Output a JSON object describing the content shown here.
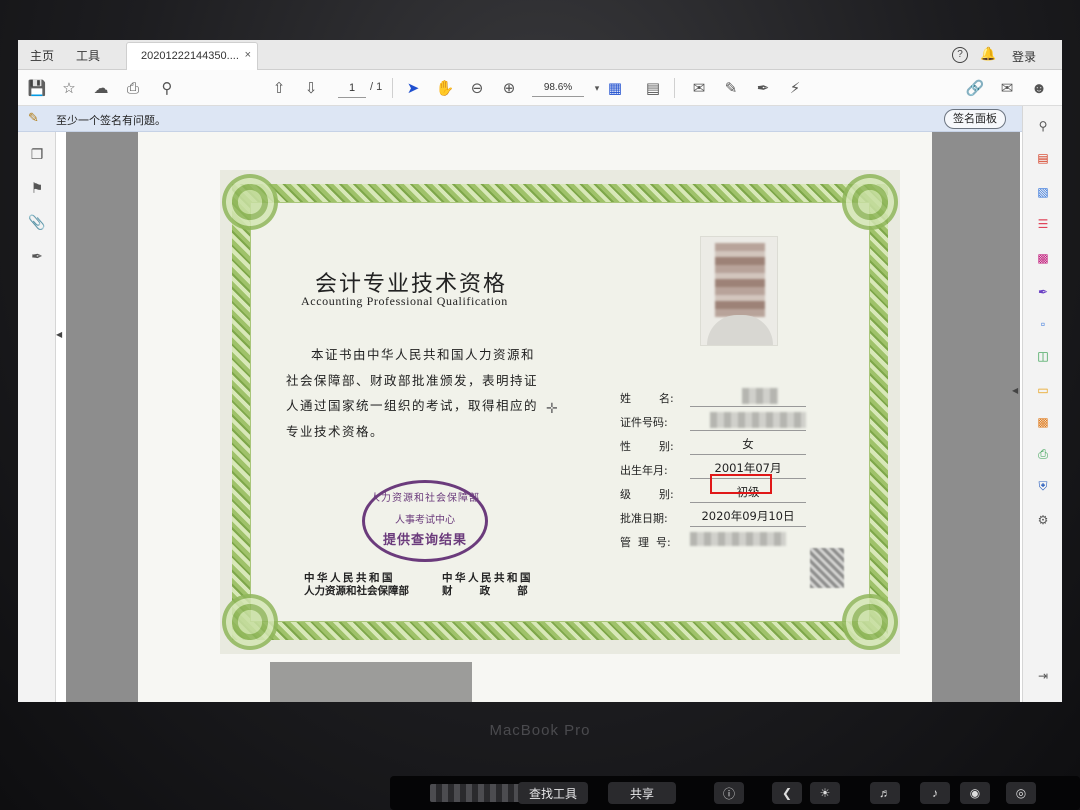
{
  "tabs": {
    "home": "主页",
    "tools": "工具",
    "document": "20201222144350....",
    "close": "×",
    "help": "?",
    "login": "登录"
  },
  "toolbar": {
    "page_current": "1",
    "page_total": "/ 1",
    "zoom": "98.6%"
  },
  "signature_bar": {
    "message": "至少一个签名有问题。",
    "panel_button": "签名面板"
  },
  "certificate": {
    "title": "会计专业技术资格",
    "subtitle": "Accounting Professional Qualification",
    "body": "本证书由中华人民共和国人力资源和社会保障部、财政部批准颁发，表明持证人通过国家统一组织的考试，取得相应的专业技术资格。",
    "stamp": {
      "arc": "人力资源和社会保障部",
      "center": "人事考试中心",
      "bottom": "提供查询结果"
    },
    "issuer_left_line1": "中华人民共和国",
    "issuer_left_line2": "人力资源和社会保障部",
    "issuer_right_line1": "中华人民共和国",
    "issuer_right_line2": "财    政    部",
    "fields": {
      "name_label": "姓        名:",
      "id_label": "证件号码:",
      "gender_label": "性        别:",
      "gender_value": "女",
      "birth_label": "出生年月:",
      "birth_value": "2001年07月",
      "level_label": "级        别:",
      "level_value": "初级",
      "approval_label": "批准日期:",
      "approval_value": "2020年09月10日",
      "manage_label": "管  理  号:"
    }
  },
  "laptop": {
    "brand": "MacBook Pro"
  },
  "touchbar": {
    "find_tool": "查找工具",
    "share": "共享"
  },
  "colors": {
    "highlight_box": "#e01818",
    "stamp": "#6b3b7c",
    "border_green": "#9fc26a"
  }
}
